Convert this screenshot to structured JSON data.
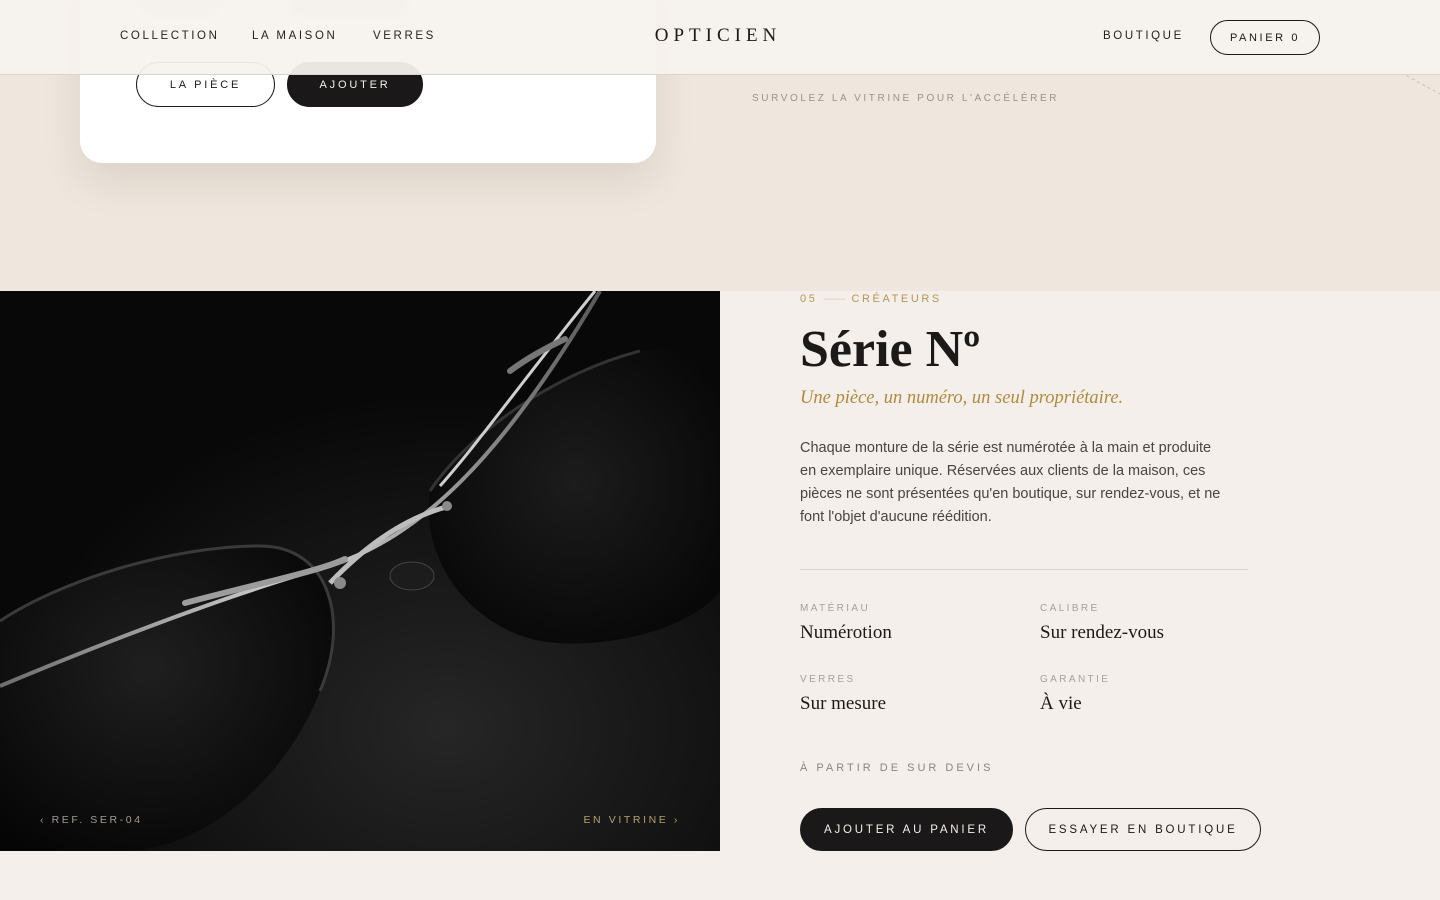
{
  "header": {
    "nav_left": [
      "COLLECTION",
      "LA MAISON",
      "VERRES"
    ],
    "logo": "OPTICIEN",
    "nav_right": {
      "shop": "BOUTIQUE",
      "cart": "PANIER 0"
    }
  },
  "showcase": {
    "card_buttons": {
      "piece": "LA PIÈCE",
      "add": "AJOUTER"
    },
    "hover_hint": "SURVOLEZ LA VITRINE POUR L'ACCÉLÉRER"
  },
  "product": {
    "image": {
      "ref_caption": "‹ REF. SER-04",
      "vitrine_caption": "EN VITRINE ›"
    },
    "eyebrow": {
      "index": "05",
      "dash": "——",
      "category": "CRÉATEURS"
    },
    "title": "Série Nº",
    "tagline": "Une pièce, un numéro, un seul propriétaire.",
    "description": "Chaque monture de la série est numérotée à la main et produite en exemplaire unique. Réservées aux clients de la maison, ces pièces ne sont présentées qu'en boutique, sur rendez-vous, et ne font l'objet d'aucune réédition.",
    "specs": [
      {
        "label": "MATÉRIAU",
        "value": "Numérotion"
      },
      {
        "label": "CALIBRE",
        "value": "Sur rendez-vous"
      },
      {
        "label": "VERRES",
        "value": "Sur mesure"
      },
      {
        "label": "GARANTIE",
        "value": "À vie"
      }
    ],
    "price_line": "À PARTIR DE SUR DEVIS",
    "buttons": {
      "add_to_cart": "AJOUTER AU PANIER",
      "try_in_store": "ESSAYER EN BOUTIQUE"
    }
  },
  "colors": {
    "background": "#f4efea",
    "band": "#efe6dd",
    "accent_gold": "#b08a3e",
    "dark": "#1a1818"
  },
  "icons": {
    "prev": "chevron-left-glyph",
    "next": "chevron-right-glyph"
  }
}
